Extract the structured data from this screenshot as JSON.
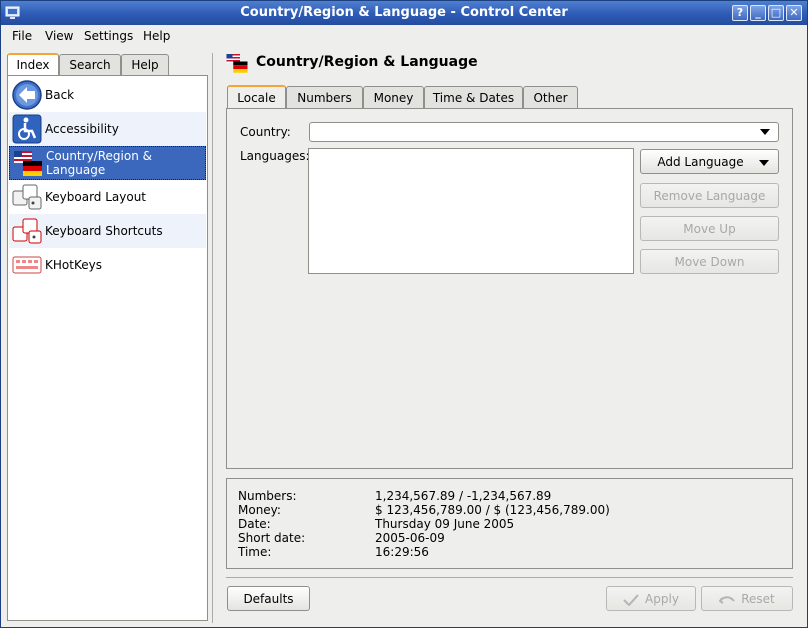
{
  "window": {
    "title": "Country/Region & Language - Control Center"
  },
  "titlebar_buttons": [
    "?",
    "_",
    "□",
    "✕"
  ],
  "menu": [
    {
      "label": "File"
    },
    {
      "label": "View"
    },
    {
      "label": "Settings"
    },
    {
      "label": "Help"
    }
  ],
  "left_tabs": [
    {
      "label": "Index",
      "active": true
    },
    {
      "label": "Search"
    },
    {
      "label": "Help"
    }
  ],
  "modules": [
    {
      "label": "Back",
      "icon": "back-arrow-icon"
    },
    {
      "label": "Accessibility",
      "icon": "wheelchair-icon"
    },
    {
      "label": "Country/Region & Language",
      "icon": "flags-icon",
      "selected": true
    },
    {
      "label": "Keyboard Layout",
      "icon": "keyboard-icon"
    },
    {
      "label": "Keyboard Shortcuts",
      "icon": "keyboard-shortcut-icon"
    },
    {
      "label": "KHotKeys",
      "icon": "hotkeys-icon"
    }
  ],
  "header": {
    "title": "Country/Region & Language"
  },
  "tabs": [
    {
      "label": "Locale",
      "active": true
    },
    {
      "label": "Numbers"
    },
    {
      "label": "Money"
    },
    {
      "label": "Time & Dates"
    },
    {
      "label": "Other"
    }
  ],
  "locale": {
    "country_label": "Country:",
    "country_value": "",
    "languages_label": "Languages:",
    "add_language": "Add Language",
    "remove_language": "Remove Language",
    "move_up": "Move Up",
    "move_down": "Move Down"
  },
  "preview": [
    {
      "label": "Numbers:",
      "value": "1,234,567.89 / -1,234,567.89"
    },
    {
      "label": "Money:",
      "value": "$ 123,456,789.00 / $ (123,456,789.00)"
    },
    {
      "label": "Date:",
      "value": "Thursday 09 June 2005"
    },
    {
      "label": "Short date:",
      "value": "2005-06-09"
    },
    {
      "label": "Time:",
      "value": "16:29:56"
    }
  ],
  "buttons": {
    "defaults": "Defaults",
    "apply": "Apply",
    "reset": "Reset"
  },
  "colors": {
    "selection": "#3b67bc",
    "titlebar": "#2d5bb5",
    "tab_accent": "#f4a53a"
  }
}
